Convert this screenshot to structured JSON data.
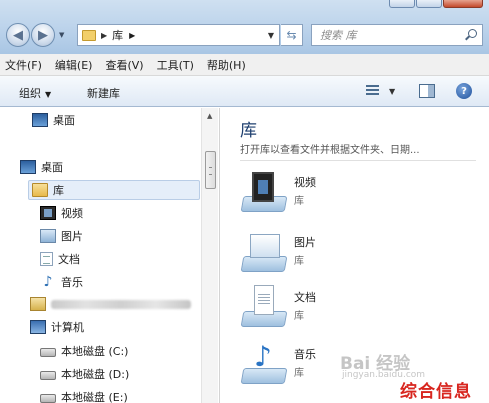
{
  "address_bar": {
    "crumb": "库",
    "refresh_icon": "refresh-icon"
  },
  "search": {
    "placeholder": "搜索 库"
  },
  "menu": [
    "文件(F)",
    "编辑(E)",
    "查看(V)",
    "工具(T)",
    "帮助(H)"
  ],
  "toolbar": {
    "organize_label": "组织",
    "new_library_label": "新建库"
  },
  "nav_pane": {
    "favorites_desktop": "桌面",
    "desktop": "桌面",
    "libraries": "库",
    "videos": "视频",
    "pictures": "图片",
    "documents": "文档",
    "music": "音乐",
    "computer": "计算机",
    "drive_c": "本地磁盘 (C:)",
    "drive_d": "本地磁盘 (D:)",
    "drive_e": "本地磁盘 (E:)"
  },
  "content": {
    "title": "库",
    "subtitle": "打开库以查看文件并根据文件夹、日期...",
    "items": [
      {
        "name": "视频",
        "category": "库"
      },
      {
        "name": "图片",
        "category": "库"
      },
      {
        "name": "文档",
        "category": "库"
      },
      {
        "name": "音乐",
        "category": "库"
      }
    ]
  },
  "watermark": {
    "text": "Bai 经验",
    "sub": "jingyan.baidu.com"
  },
  "stamp": "综合信息"
}
